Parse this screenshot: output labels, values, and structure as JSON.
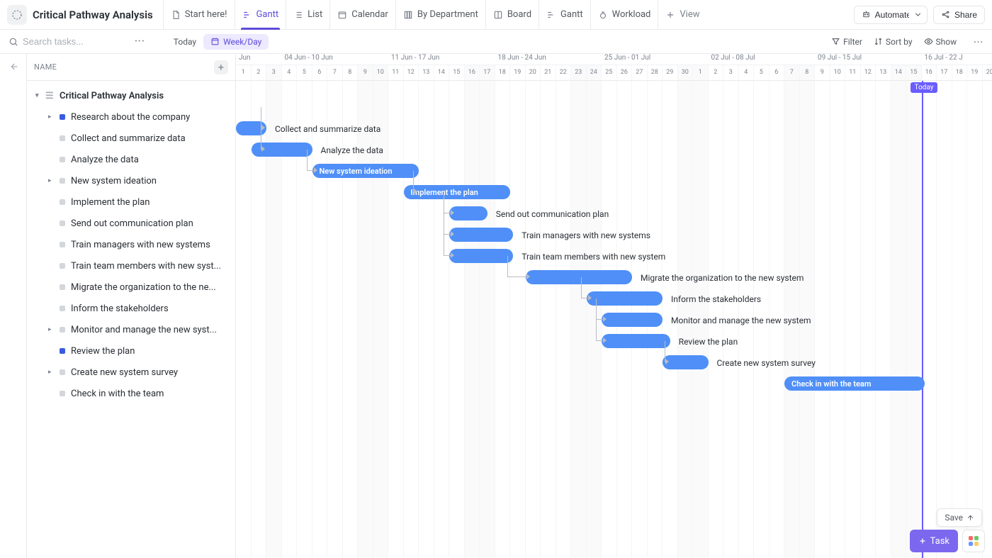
{
  "dayWidth": 21.5,
  "colors": {
    "accent": "#5d4bdb",
    "bar": "#4f8ff7",
    "today": "#6a5cff"
  },
  "header": {
    "title": "Critical Pathway Analysis",
    "tabs": [
      {
        "label": "Start here!",
        "icon": "doc"
      },
      {
        "label": "Gantt",
        "icon": "gantt",
        "active": true
      },
      {
        "label": "List",
        "icon": "list"
      },
      {
        "label": "Calendar",
        "icon": "calendar"
      },
      {
        "label": "By Department",
        "icon": "columns"
      },
      {
        "label": "Board",
        "icon": "board"
      },
      {
        "label": "Gantt",
        "icon": "gantt"
      },
      {
        "label": "Workload",
        "icon": "workload"
      }
    ],
    "addView": "View",
    "automate": "Automate",
    "share": "Share"
  },
  "toolbar": {
    "searchPlaceholder": "Search tasks...",
    "today": "Today",
    "scale": "Week/Day",
    "filter": "Filter",
    "sort": "Sort by",
    "show": "Show"
  },
  "sidebar": {
    "heading": "NAME",
    "folder": "Critical Pathway Analysis",
    "tasks": [
      {
        "label": "Research about the company",
        "status": "blue",
        "expandable": true
      },
      {
        "label": "Collect and summarize data",
        "status": "grey"
      },
      {
        "label": "Analyze the data",
        "status": "grey"
      },
      {
        "label": "New system ideation",
        "status": "grey",
        "expandable": true
      },
      {
        "label": "Implement the plan",
        "status": "grey"
      },
      {
        "label": "Send out communication plan",
        "status": "grey"
      },
      {
        "label": "Train managers with new systems",
        "status": "grey"
      },
      {
        "label": "Train team members with new syst...",
        "status": "grey"
      },
      {
        "label": "Migrate the organization to the ne...",
        "status": "grey"
      },
      {
        "label": "Inform the stakeholders",
        "status": "grey"
      },
      {
        "label": "Monitor and manage the new syst...",
        "status": "grey",
        "expandable": true
      },
      {
        "label": "Review the plan",
        "status": "blue"
      },
      {
        "label": "Create new system survey",
        "status": "grey",
        "expandable": true
      },
      {
        "label": "Check in with the team",
        "status": "grey"
      }
    ]
  },
  "timeline": {
    "weeks": [
      {
        "label": "Jun",
        "days": 3
      },
      {
        "label": "04 Jun - 10 Jun",
        "days": 7
      },
      {
        "label": "11 Jun - 17 Jun",
        "days": 7
      },
      {
        "label": "18 Jun - 24 Jun",
        "days": 7
      },
      {
        "label": "25 Jun - 01 Jul",
        "days": 7
      },
      {
        "label": "02 Jul - 08 Jul",
        "days": 7
      },
      {
        "label": "09 Jul - 15 Jul",
        "days": 7
      },
      {
        "label": "16 Jul - 22 J",
        "days": 5
      }
    ],
    "days": [
      1,
      2,
      3,
      4,
      5,
      6,
      7,
      8,
      9,
      10,
      11,
      12,
      13,
      14,
      15,
      16,
      17,
      18,
      19,
      20,
      21,
      22,
      23,
      24,
      25,
      26,
      27,
      28,
      29,
      30,
      1,
      2,
      3,
      4,
      5,
      6,
      7,
      8,
      9,
      10,
      11,
      12,
      13,
      14,
      15,
      16,
      17,
      18,
      19,
      20
    ],
    "weekendIdx": [
      2,
      8,
      9,
      15,
      16,
      22,
      23,
      29,
      30,
      36,
      37,
      43,
      44
    ],
    "todayCol": 45,
    "todayLabel": "Today"
  },
  "bars": [
    {
      "row": 1,
      "start": 0,
      "len": 2,
      "label": "Collect and summarize data",
      "out": true,
      "dep": {
        "fromRow": 0,
        "fromEnd": 2
      }
    },
    {
      "row": 2,
      "start": 1,
      "len": 4,
      "label": "Analyze the data",
      "out": true,
      "dep": {
        "fromRow": 1,
        "fromEnd": 2
      }
    },
    {
      "row": 3,
      "start": 5,
      "len": 7,
      "label": "New system ideation",
      "dep": {
        "fromRow": 2,
        "fromEnd": 5
      }
    },
    {
      "row": 4,
      "start": 11,
      "len": 7,
      "label": "Implement the plan",
      "dep": {
        "fromRow": 3,
        "fromEnd": 12
      }
    },
    {
      "row": 5,
      "start": 14,
      "len": 2.5,
      "label": "Send out communication plan",
      "out": true,
      "dep": {
        "fromRow": 4,
        "fromEnd": 14
      }
    },
    {
      "row": 6,
      "start": 14,
      "len": 4.2,
      "label": "Train managers with new systems",
      "out": true,
      "dep": {
        "fromRow": 4,
        "fromEnd": 14
      }
    },
    {
      "row": 7,
      "start": 14,
      "len": 4.2,
      "label": "Train team members with new system",
      "out": true,
      "dep": {
        "fromRow": 4,
        "fromEnd": 14
      }
    },
    {
      "row": 8,
      "start": 19,
      "len": 7,
      "label": "Migrate the organization to the new system",
      "out": true,
      "dep": {
        "fromRow": 7,
        "fromEnd": 18.2
      }
    },
    {
      "row": 9,
      "start": 23,
      "len": 5,
      "label": "Inform the stakeholders",
      "out": true,
      "dep": {
        "fromRow": 8,
        "fromEnd": 23
      }
    },
    {
      "row": 10,
      "start": 24,
      "len": 4,
      "label": "Monitor and manage the new system",
      "out": true,
      "dep": {
        "fromRow": 9,
        "fromEnd": 24
      }
    },
    {
      "row": 11,
      "start": 24,
      "len": 4.5,
      "label": "Review the plan",
      "out": true,
      "dep": {
        "fromRow": 9,
        "fromEnd": 24
      }
    },
    {
      "row": 12,
      "start": 28,
      "len": 3,
      "label": "Create new system survey",
      "out": true,
      "dep": {
        "fromRow": 11,
        "fromEnd": 28.5
      }
    },
    {
      "row": 13,
      "start": 36,
      "len": 9.2,
      "label": "Check in with the team"
    }
  ],
  "fab": {
    "task": "Task",
    "save": "Save"
  }
}
